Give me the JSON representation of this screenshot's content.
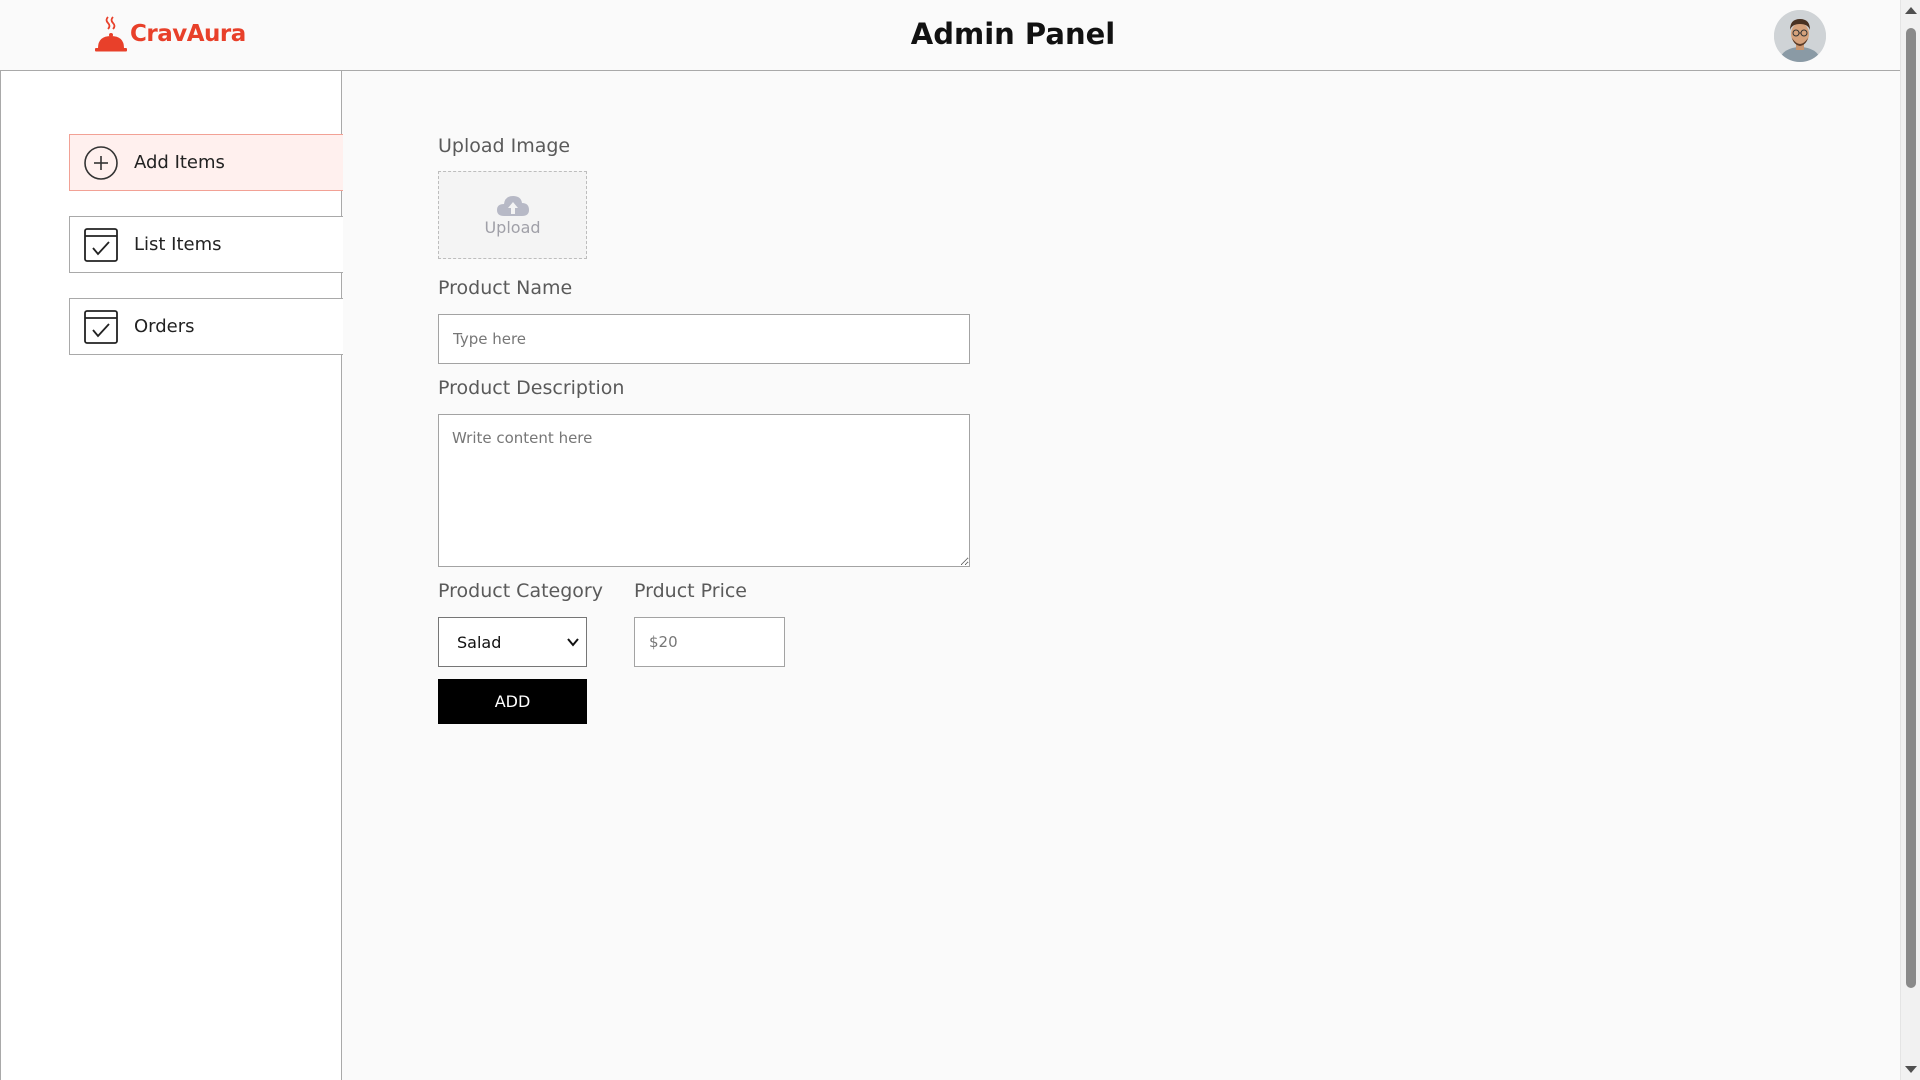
{
  "header": {
    "brand": "CravAura",
    "title": "Admin Panel",
    "brand_color": "#e8402a"
  },
  "sidebar": {
    "items": [
      {
        "label": "Add Items",
        "icon": "add-circle-icon",
        "active": true
      },
      {
        "label": "List Items",
        "icon": "checklist-icon",
        "active": false
      },
      {
        "label": "Orders",
        "icon": "checklist-icon",
        "active": false
      }
    ]
  },
  "form": {
    "upload_label": "Upload Image",
    "upload_text": "Upload",
    "name_label": "Product Name",
    "name_placeholder": "Type here",
    "desc_label": "Product Description",
    "desc_placeholder": "Write content here",
    "category_label": "Product Category",
    "category_value": "Salad",
    "price_label": "Prduct Price",
    "price_placeholder": "$20",
    "add_button": "ADD"
  }
}
